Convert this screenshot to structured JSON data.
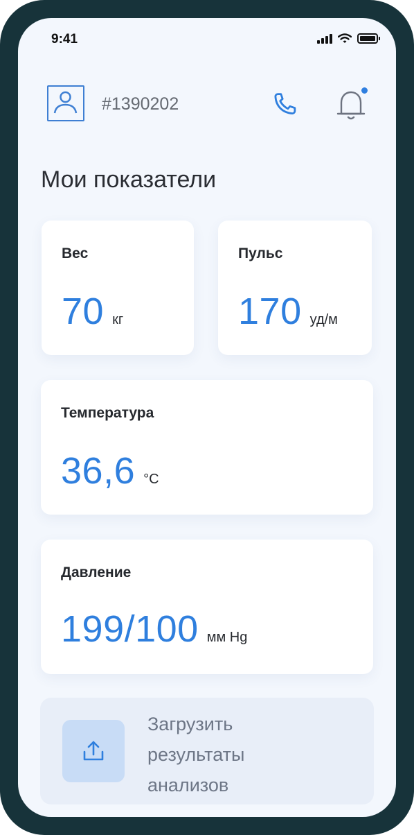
{
  "status_bar": {
    "time": "9:41"
  },
  "header": {
    "patient_id": "#1390202"
  },
  "page": {
    "title": "Мои показатели"
  },
  "metrics": {
    "weight": {
      "label": "Вес",
      "value": "70",
      "unit": "кг"
    },
    "pulse": {
      "label": "Пульс",
      "value": "170",
      "unit": "уд/м"
    },
    "temperature": {
      "label": "Температура",
      "value": "36,6",
      "unit": "°C"
    },
    "pressure": {
      "label": "Давление",
      "value": "199/100",
      "unit": "мм Hg"
    }
  },
  "upload": {
    "label": "Загрузить результаты анализов"
  },
  "colors": {
    "accent": "#2f7fde",
    "frame": "#17333a",
    "background": "#f3f7fd",
    "upload_bg": "#e8eef8",
    "upload_icon_bg": "#c8dcf6"
  },
  "icons": [
    "user-icon",
    "phone-icon",
    "bell-icon",
    "notification-dot",
    "upload-icon",
    "signal-icon",
    "wifi-icon",
    "battery-icon"
  ]
}
